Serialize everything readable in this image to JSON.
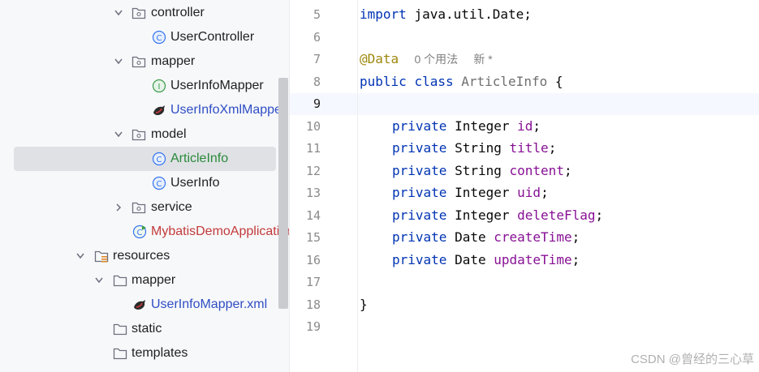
{
  "tree": {
    "items": [
      {
        "label": "controller"
      },
      {
        "label": "UserController"
      },
      {
        "label": "mapper"
      },
      {
        "label": "UserInfoMapper"
      },
      {
        "label": "UserInfoXmlMapper"
      },
      {
        "label": "model"
      },
      {
        "label": "ArticleInfo"
      },
      {
        "label": "UserInfo"
      },
      {
        "label": "service"
      },
      {
        "label": "MybatisDemoApplication"
      },
      {
        "label": "resources"
      },
      {
        "label": "mapper"
      },
      {
        "label": "UserInfoMapper.xml"
      },
      {
        "label": "static"
      },
      {
        "label": "templates"
      }
    ]
  },
  "editor": {
    "line_numbers": [
      "5",
      "6",
      "7",
      "8",
      "9",
      "10",
      "11",
      "12",
      "13",
      "14",
      "15",
      "16",
      "17",
      "18",
      "19"
    ],
    "current_line": "9",
    "import_kw": "import",
    "import_path": "java.util.Date;",
    "annotation": "@Data",
    "usages_hint": "0 个用法",
    "new_hint": "新 *",
    "class_decl": {
      "public": "public",
      "class": "class",
      "name": "ArticleInfo",
      "brace": "{"
    },
    "fields": [
      {
        "mod": "private",
        "type": "Integer",
        "name": "id"
      },
      {
        "mod": "private",
        "type": "String",
        "name": "title"
      },
      {
        "mod": "private",
        "type": "String",
        "name": "content"
      },
      {
        "mod": "private",
        "type": "Integer",
        "name": "uid"
      },
      {
        "mod": "private",
        "type": "Integer",
        "name": "deleteFlag"
      },
      {
        "mod": "private",
        "type": "Date",
        "name": "createTime"
      },
      {
        "mod": "private",
        "type": "Date",
        "name": "updateTime"
      }
    ],
    "close_brace": "}"
  },
  "watermark": "CSDN @曾经的三心草",
  "colors": {
    "keyword": "#0033b3",
    "field": "#871094",
    "annotation": "#9e880d",
    "selection": "#dfe1e5"
  }
}
